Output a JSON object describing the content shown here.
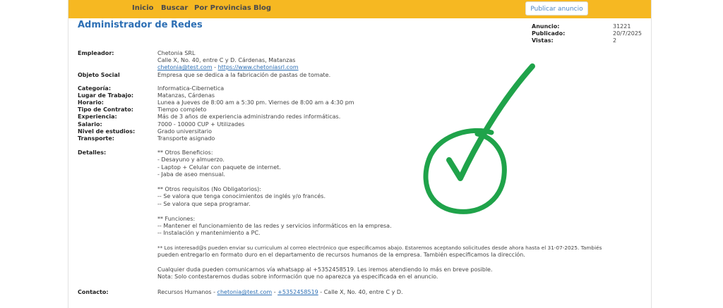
{
  "nav": {
    "items": [
      "Inicio",
      "Buscar",
      "Por Provincias",
      "Blog"
    ],
    "publish_label": "Publicar anuncio"
  },
  "title": "Administrador de Redes",
  "meta": [
    {
      "label": "Anuncio:",
      "value": "31221"
    },
    {
      "label": "Publicado:",
      "value": "20/7/2025"
    },
    {
      "label": "Vistas:",
      "value": "2"
    }
  ],
  "employer": {
    "label": "Empleador:",
    "name": "Chetonia SRL",
    "address": "Calle X, No. 40, entre C y D. Cárdenas, Matanzas",
    "email": "chetonia@test.com",
    "sep": " - ",
    "website": "https://www.chetoniasrl.com"
  },
  "objeto": {
    "label": "Objeto Social",
    "value": "Empresa que se dedica a la fabricación de pastas de tomate."
  },
  "fields": [
    {
      "label": "Categoría:",
      "value": "Informatica-Cibernetica"
    },
    {
      "label": "Lugar de Trabajo:",
      "value": "Matanzas, Cárdenas"
    },
    {
      "label": "Horario:",
      "value": "Lunea a Jueves de 8:00 am a 5:30 pm. Viernes de 8:00 am a 4:30 pm"
    },
    {
      "label": "Tipo de Contrato:",
      "value": "Tiempo completo"
    },
    {
      "label": "Experiencia:",
      "value": "Más de 3 años de experiencia administrando redes informáticas."
    },
    {
      "label": "Salario:",
      "value": "7000 - 10000 CUP + Utilizades"
    },
    {
      "label": "Nivel de estudios:",
      "value": "Grado universitario"
    },
    {
      "label": "Transporte:",
      "value": "Transporte asignado"
    }
  ],
  "details": {
    "label": "Detalles:",
    "lines": [
      "** Otros Beneficios:",
      "- Desayuno y almuerzo.",
      "- Laptop + Celular con paquete de internet.",
      "- Jaba de aseo mensual.",
      "** Otros requisitos (No Obligatorios):",
      "-- Se valora que tenga conocimientos de inglés y/o francés.",
      "-- Se valora que sepa programar.",
      "** Funciones:",
      "-- Mantener el funcionamiento de las redes y servicios informáticos en la empresa.",
      "-- Instalación y mantenimiento a PC.",
      "** Los interesad@s pueden enviar su curriculum al correo electrónico que especificamos abajo. Estaremos aceptando solicitudes desde ahora hasta el 31-07-2025. Tambiés",
      "pueden entregarlo en formato duro en el departamento de recursos humanos de la empresa. También especificamos la dirección.",
      "Cualquier duda pueden comunicarnos vía whatsapp al +5352458519.  Les iremos atendiendo lo más en breve posible.",
      "Nota: Solo contestaremos dudas sobre información que no aparezca ya especificada en el anuncio."
    ]
  },
  "contact": {
    "label": "Contacto:",
    "prefix": "Recursos Humanos - ",
    "email": "chetonia@test.com",
    "sep": " - ",
    "phone": "+5352458519",
    "suffix": " - Calle X, No. 40, entre C y D."
  },
  "overlay": {
    "icon": "green-checkmark",
    "color": "#1fa34a"
  },
  "colors": {
    "navbar": "#f6b822",
    "title": "#2d6fb4",
    "link": "#2d6fb4"
  }
}
